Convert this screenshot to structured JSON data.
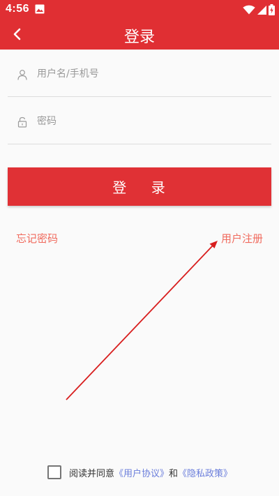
{
  "status_bar": {
    "time": "4:56"
  },
  "header": {
    "title": "登录"
  },
  "form": {
    "username_placeholder": "用户名/手机号",
    "password_placeholder": "密码",
    "login_label": "登    录"
  },
  "links": {
    "forgot_password": "忘记密码",
    "register": "用户注册"
  },
  "agreement": {
    "prefix": "阅读并同意",
    "user_agreement": "《用户协议》",
    "conjunction": "和",
    "privacy_policy": "《隐私政策》"
  },
  "colors": {
    "brand_red": "#e02f33",
    "link_orange": "#f06a5d",
    "link_blue": "#6a7ddb",
    "annotation_red": "#d81e1e"
  }
}
